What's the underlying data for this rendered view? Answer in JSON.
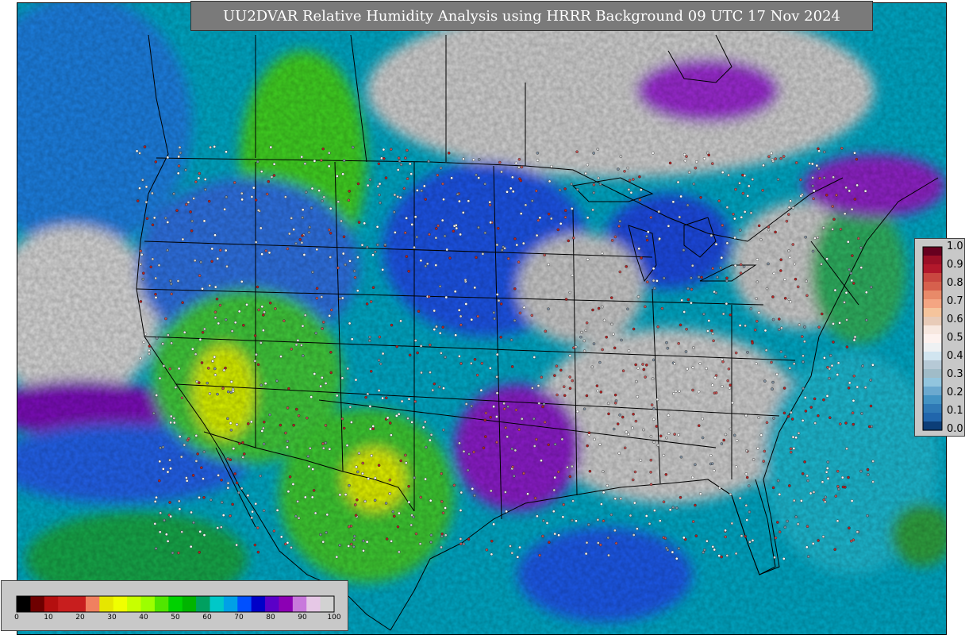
{
  "title": "UU2DVAR Relative Humidity Analysis using HRRR Background 09 UTC 17 Nov 2024",
  "rh_legend": {
    "ticks": [
      "1.0",
      "0.9",
      "0.8",
      "0.7",
      "0.6",
      "0.5",
      "0.4",
      "0.3",
      "0.2",
      "0.1",
      "0.0"
    ],
    "colors": [
      "#67001f",
      "#9b0f26",
      "#b2182b",
      "#c94740",
      "#d6604d",
      "#e88a69",
      "#f4a582",
      "#f5c49c",
      "#e8cbb8",
      "#f7e8e0",
      "#fdf2ef",
      "#eef1f3",
      "#d1e5f0",
      "#b6c9d6",
      "#a0bcc8",
      "#92c5de",
      "#6ba9cf",
      "#4393c3",
      "#2f79b5",
      "#2166ac",
      "#0c3e78"
    ]
  },
  "bottom_legend": {
    "ticks": [
      "0",
      "10",
      "20",
      "30",
      "40",
      "50",
      "60",
      "70",
      "80",
      "90",
      "100"
    ],
    "colors": [
      "#000000",
      "#6e0000",
      "#b40f0f",
      "#c81e1e",
      "#c81e1e",
      "#f08060",
      "#e6e600",
      "#f0ff00",
      "#c8ff00",
      "#9cff00",
      "#50e600",
      "#00d200",
      "#00b400",
      "#00a060",
      "#00c8c8",
      "#00a0e6",
      "#0050ff",
      "#0000c8",
      "#5a00c8",
      "#8c00b4",
      "#c878dc",
      "#e6c8e6",
      "#d2d2d2"
    ]
  }
}
